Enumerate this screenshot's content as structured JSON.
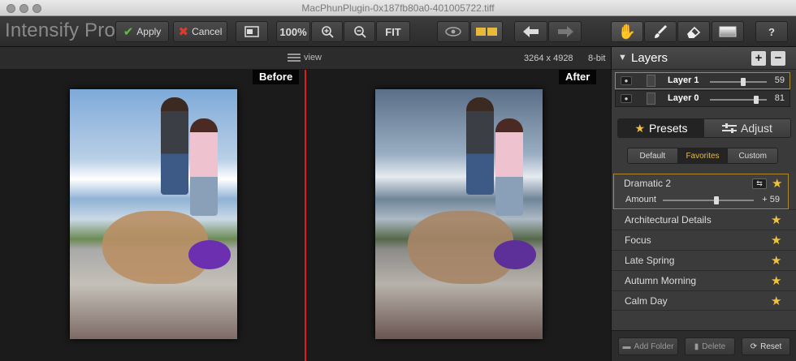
{
  "window": {
    "title": "MacPhunPlugin-0x187fb80a0-401005722.tiff"
  },
  "toolbar": {
    "app_name": "Intensify Pro",
    "apply_label": "Apply",
    "cancel_label": "Cancel",
    "zoom_100_label": "100%",
    "fit_label": "FIT"
  },
  "viewbar": {
    "view_label": "view",
    "image_size": "3264 x 4928",
    "bit_depth": "8-bit"
  },
  "canvas": {
    "before_label": "Before",
    "after_label": "After"
  },
  "layers": {
    "title": "Layers",
    "add_label": "+",
    "remove_label": "−",
    "items": [
      {
        "name": "Layer 1",
        "value": "59",
        "opacity": 0.59,
        "selected": true
      },
      {
        "name": "Layer 0",
        "value": "81",
        "opacity": 0.81,
        "selected": false
      }
    ]
  },
  "tabs": {
    "presets_label": "Presets",
    "adjust_label": "Adjust"
  },
  "subtabs": {
    "default_label": "Default",
    "favorites_label": "Favorites",
    "custom_label": "Custom"
  },
  "presets": {
    "active": {
      "name": "Dramatic 2",
      "amount_label": "Amount",
      "amount_value": "+ 59",
      "amount": 0.59
    },
    "items": [
      {
        "name": "Architectural Details"
      },
      {
        "name": "Focus"
      },
      {
        "name": "Late Spring"
      },
      {
        "name": "Autumn Morning"
      },
      {
        "name": "Calm Day"
      }
    ]
  },
  "footer": {
    "add_folder_label": "Add Folder",
    "delete_label": "Delete",
    "reset_label": "Reset"
  },
  "colors": {
    "accent_gold": "#f2c23a",
    "divider_red": "#e01818",
    "selection_border": "#b08a2a"
  }
}
